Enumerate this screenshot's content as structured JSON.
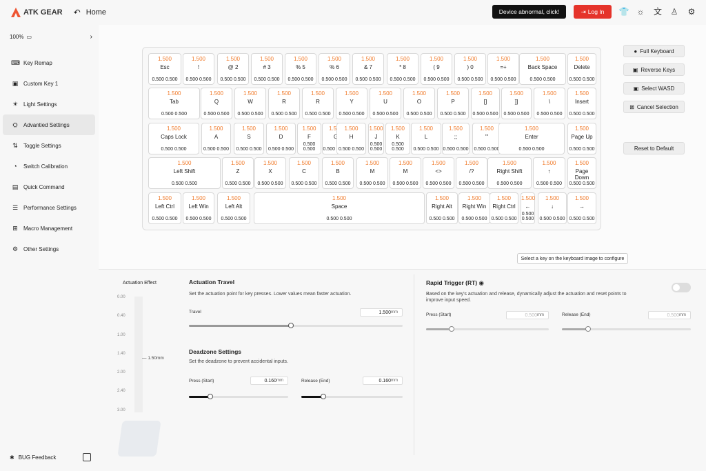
{
  "topbar": {
    "brand": "ATK GEAR",
    "home_label": "Home",
    "device_alert": "Device abnormal, click!",
    "login_label": "Log In",
    "icons": [
      "tshirt-icon",
      "brightness-icon",
      "translate-icon",
      "user-icon",
      "gear-icon"
    ]
  },
  "sidebar": {
    "zoom": "100%",
    "items": [
      {
        "label": "Key Remap",
        "icon": "keyboard-icon"
      },
      {
        "label": "Custom Key 1",
        "icon": "custom-key-icon"
      },
      {
        "label": "Light Settings",
        "icon": "light-icon"
      },
      {
        "label": "Advantied Settings",
        "icon": "advanced-icon"
      },
      {
        "label": "Toggle Settings",
        "icon": "toggle-icon"
      },
      {
        "label": "Switch Calibration",
        "icon": "calibration-icon"
      },
      {
        "label": "Quick Command",
        "icon": "command-icon"
      },
      {
        "label": "Performance Settings",
        "icon": "performance-icon"
      },
      {
        "label": "Macro Management",
        "icon": "macro-icon"
      },
      {
        "label": "Other Settings",
        "icon": "settings-icon"
      }
    ],
    "active_index": 3,
    "bug_feedback": "BUG Feedback"
  },
  "keyboard": {
    "default_travel": "1.500",
    "default_press": "0.500",
    "default_release": "0.500",
    "keys": [
      "Esc",
      "!",
      "@ 2",
      "# 3",
      "% 5",
      "% 6",
      "& 7",
      "* 8",
      "( 9",
      ") 0",
      "=+",
      "Back Space",
      "Delete",
      "Tab",
      "Q",
      "W",
      "R",
      "R",
      "Y",
      "U",
      "O",
      "P",
      "[]",
      "]]",
      "\\",
      "Insert",
      "Caps Lock",
      "A",
      "S",
      "D",
      "F",
      "G",
      "H",
      "J",
      "K",
      "L",
      ";;",
      "'\"",
      "Enter",
      "Page Up",
      "Left Shift",
      "Z",
      "X",
      "C",
      "B",
      "M",
      "M",
      "<>",
      "/?",
      "Right Shift",
      "↑",
      "Page Down",
      "Left Ctrl",
      "Left Win",
      "Left Alt",
      "Space",
      "Right Alt",
      "Right Win",
      "Right Ctrl",
      "←",
      "↓",
      "→"
    ]
  },
  "actions": {
    "full_keyboard": "Full Keyboard",
    "reverse_keys": "Reverse Keys",
    "select_wasd": "Select WASD",
    "cancel_selection": "Cancel Selection",
    "reset_default": "Reset to Default"
  },
  "tooltip": "Select a key on the keyboard image to configure",
  "actuation_effect": {
    "label": "Actuation Effect",
    "scale": [
      "0.00",
      "0.40",
      "1.00",
      "1.40",
      "2.00",
      "2.40",
      "3.00"
    ],
    "marker": "1.50mm"
  },
  "actuation_travel": {
    "title": "Actuation Travel",
    "desc": "Set the actuation point for key presses. Lower values mean faster actuation.",
    "travel_label": "Travel",
    "travel_value": "1.500",
    "unit": "mm",
    "travel_fraction": 0.5
  },
  "deadzone": {
    "title": "Deadzone Settings",
    "desc": "Set the deadzone to prevent accidental inputs.",
    "press_label": "Press (Start)",
    "press_value": "0.160",
    "release_label": "Release (End)",
    "release_value": "0.160",
    "unit": "mm"
  },
  "rapid_trigger": {
    "title": "Rapid Trigger (RT)",
    "desc": "Based on the key's actuation and release, dynamically adjust the actuation and reset points to improve input speed.",
    "press_label": "Press (Start)",
    "press_value": "0.500",
    "release_label": "Release (End)",
    "release_value": "0.500",
    "unit": "mm",
    "enabled": false
  }
}
